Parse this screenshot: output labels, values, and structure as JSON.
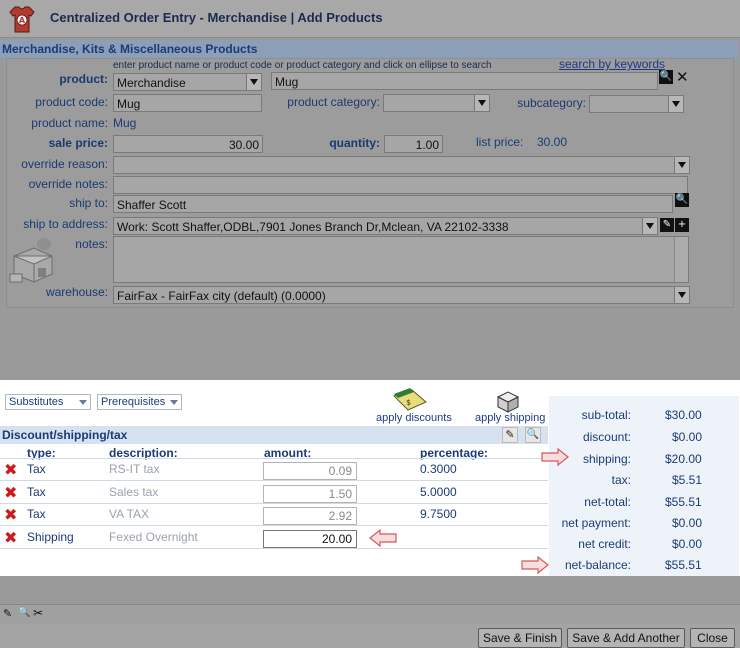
{
  "window": {
    "title": "Centralized Order Entry - Merchandise | Add Products"
  },
  "section": {
    "title": "Merchandise, Kits & Miscellaneous Products"
  },
  "form": {
    "hint": "enter product name or product code or product category and click on ellipse to search",
    "search_keywords_link": "search by keywords",
    "product_label": "product:",
    "product_type_value": "Merchandise",
    "product_value": "Mug",
    "product_code_label": "product code:",
    "product_code_value": "Mug",
    "product_category_label": "product category:",
    "subcategory_label": "subcategory:",
    "product_name_label": "product name:",
    "product_name_value": "Mug",
    "sale_price_label": "sale price:",
    "sale_price_value": "30.00",
    "quantity_label": "quantity:",
    "quantity_value": "1.00",
    "list_price_label": "list price:",
    "list_price_value": "30.00",
    "override_reason_label": "override reason:",
    "override_notes_label": "override notes:",
    "ship_to_label": "ship to:",
    "ship_to_value": "Shaffer Scott",
    "ship_to_address_label": "ship to address:",
    "ship_to_address_value": "Work: Scott Shaffer,ODBL,7901 Jones Branch Dr,Mclean, VA 22102-3338",
    "notes_label": "notes:",
    "warehouse_label": "warehouse:",
    "warehouse_value": "FairFax - FairFax city (default) (0.0000)"
  },
  "lower": {
    "substitutes": "Substitutes",
    "prerequisites": "Prerequisites",
    "apply_discounts": "apply discounts",
    "apply_shipping": "apply shipping",
    "discount_title": "Discount/shipping/tax",
    "headers": {
      "type": "type:",
      "description": "description:",
      "amount": "amount:",
      "percentage": "percentage:"
    },
    "rows": [
      {
        "type": "Tax",
        "description": "RS-IT tax",
        "amount": "0.09",
        "percentage": "0.3000"
      },
      {
        "type": "Tax",
        "description": "Sales tax",
        "amount": "1.50",
        "percentage": "5.0000"
      },
      {
        "type": "Tax",
        "description": "VA TAX",
        "amount": "2.92",
        "percentage": "9.7500"
      },
      {
        "type": "Shipping",
        "description": "Fexed Overnight",
        "amount": "20.00",
        "percentage": ""
      }
    ]
  },
  "totals": [
    {
      "label": "sub-total:",
      "value": "$30.00"
    },
    {
      "label": "discount:",
      "value": "$0.00"
    },
    {
      "label": "shipping:",
      "value": "$20.00"
    },
    {
      "label": "tax:",
      "value": "$5.51"
    },
    {
      "label": "net-total:",
      "value": "$55.51"
    },
    {
      "label": "net payment:",
      "value": "$0.00"
    },
    {
      "label": "net credit:",
      "value": "$0.00"
    },
    {
      "label": "net-balance:",
      "value": "$55.51"
    }
  ],
  "footer": {
    "save_finish": "Save & Finish",
    "save_add_another": "Save & Add Another",
    "close": "Close"
  },
  "colors": {
    "accent": "#1b3b76",
    "delete": "#d01a1a",
    "overlay": "#9c9c9c"
  }
}
